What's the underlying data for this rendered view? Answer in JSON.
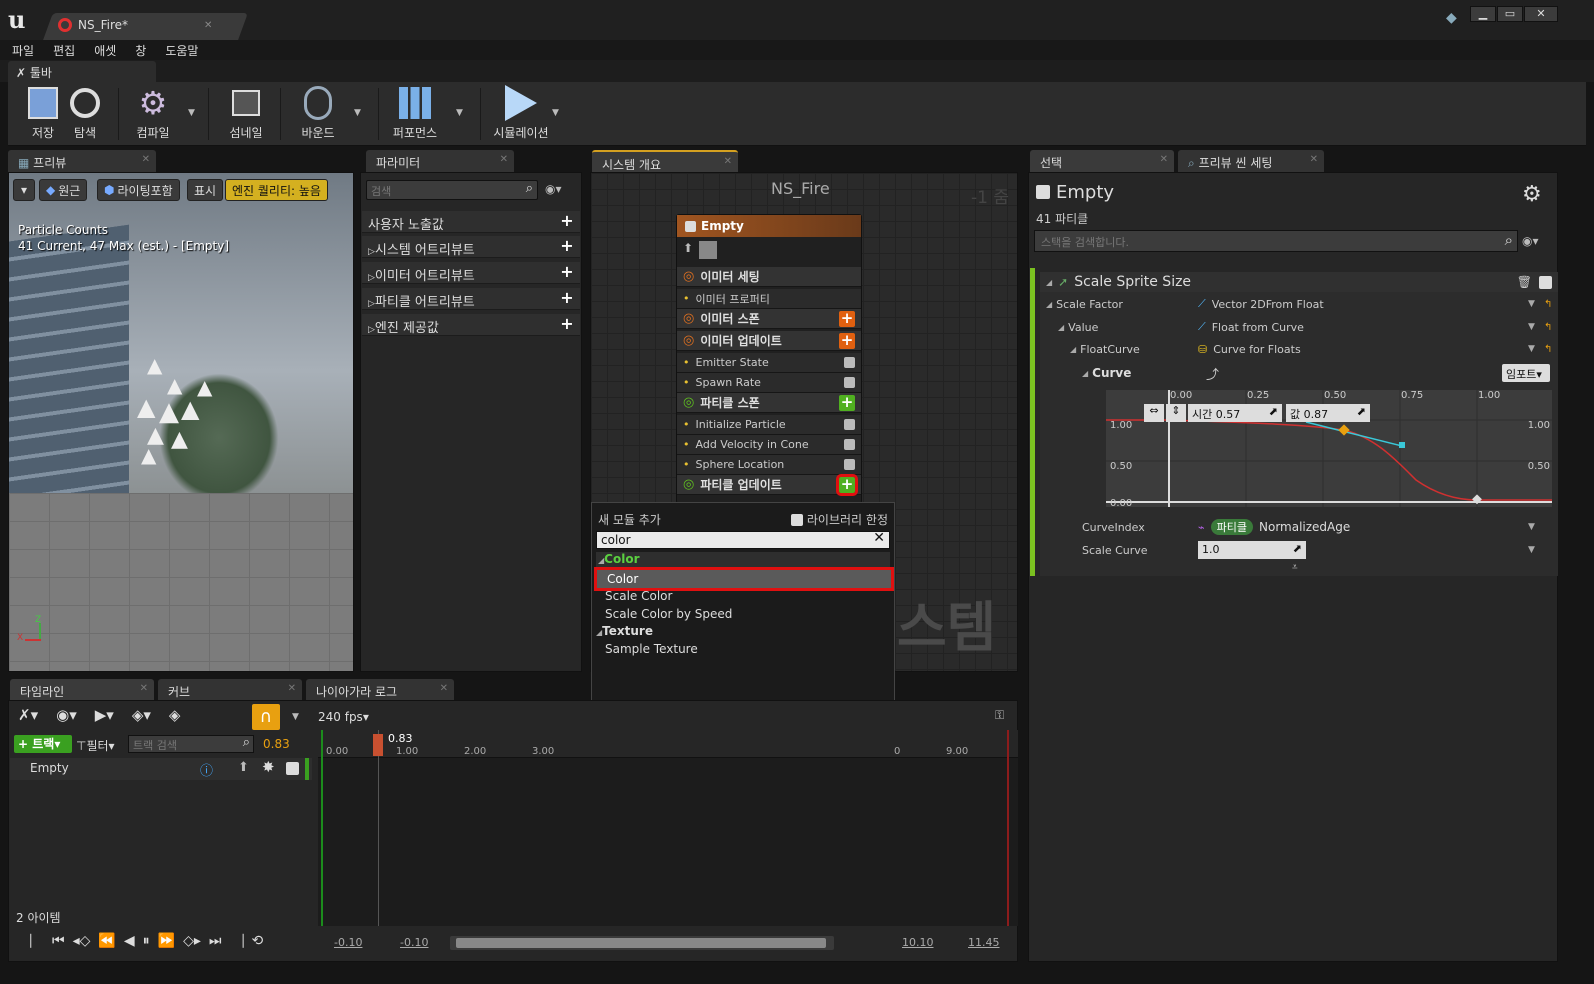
{
  "titlebar": {
    "tab_title": "NS_Fire*"
  },
  "menu": [
    "파일",
    "편집",
    "애셋",
    "창",
    "도움말"
  ],
  "toolbar_tab": "툴바",
  "toolbar": {
    "save": "저장",
    "browse": "탐색",
    "compile": "컴파일",
    "thumbnail": "섬네일",
    "bounds": "바운드",
    "performance": "퍼포먼스",
    "simulation": "시뮬레이션"
  },
  "preview": {
    "tab": "프리뷰",
    "perspective": "원근",
    "lighting": "라이팅포함",
    "show": "표시",
    "quality": "엔진 퀄리티: 높음",
    "stats_title": "Particle Counts",
    "stats_line": "41 Current, 47 Max (est.) - [Empty]"
  },
  "parameters": {
    "tab": "파라미터",
    "search_placeholder": "검색",
    "items": [
      "사용자 노출값",
      "시스템 어트리뷰트",
      "이미터 어트리뷰트",
      "파티클 어트리뷰트",
      "엔진 제공값"
    ]
  },
  "system_overview": {
    "tab": "시스템 개요",
    "title": "NS_Fire",
    "zoom": "-1 줌",
    "watermark": "스템",
    "node": {
      "name": "Empty",
      "sections": [
        {
          "label": "이미터 세팅",
          "type": "head",
          "color": "#e07020"
        },
        {
          "label": "이미터 프로퍼티",
          "type": "sub"
        },
        {
          "label": "이미터 스폰",
          "type": "head",
          "color": "#e07020",
          "add": "#e06010"
        },
        {
          "label": "이미터 업데이트",
          "type": "head",
          "color": "#e07020",
          "add": "#e06010"
        },
        {
          "label": "Emitter State",
          "type": "sub",
          "check": true
        },
        {
          "label": "Spawn Rate",
          "type": "sub",
          "check": true
        },
        {
          "label": "파티클 스폰",
          "type": "head",
          "color": "#60c020",
          "add": "#50b020"
        },
        {
          "label": "Initialize Particle",
          "type": "sub",
          "check": true
        },
        {
          "label": "Add Velocity in Cone",
          "type": "sub",
          "check": true
        },
        {
          "label": "Sphere Location",
          "type": "sub",
          "check": true
        },
        {
          "label": "파티클 업데이트",
          "type": "head",
          "color": "#60c020",
          "add": "#50b020"
        }
      ]
    }
  },
  "popup": {
    "title": "새 모듈 추가",
    "library_only": "라이브러리 한정",
    "search_value": "color",
    "groups": [
      {
        "name": "Color",
        "items": [
          "Color",
          "Scale Color",
          "Scale Color by Speed"
        ]
      },
      {
        "name": "Texture",
        "items": [
          "Sample Texture"
        ]
      }
    ]
  },
  "timeline": {
    "tabs": [
      "타임라인",
      "커브",
      "나이아가라 로그"
    ],
    "fps": "240 fps",
    "track_btn": "트랙",
    "filter_btn": "필터",
    "search_placeholder": "트랙 검색",
    "time_value": "0.83",
    "playhead": "0.83",
    "ruler": [
      "0.00",
      "1.00",
      "2.00",
      "3.00",
      "9.00"
    ],
    "ruler_partial": "0",
    "track": "Empty",
    "item_count": "2 아이템",
    "range_start": "-0.10",
    "range_start2": "-0.10",
    "range_end": "10.10",
    "range_end2": "11.45"
  },
  "details": {
    "tabs": [
      "선택",
      "프리뷰 씬 세팅"
    ],
    "title": "Empty",
    "subtitle": "41 파티클",
    "search_placeholder": "스택을 검색합니다.",
    "module": "Scale Sprite Size",
    "rows": [
      {
        "label": "Scale Factor",
        "value": "Vector 2DFrom Float"
      },
      {
        "label": "Value",
        "value": "Float from Curve"
      },
      {
        "label": "FloatCurve",
        "value": "Curve for Floats"
      },
      {
        "label": "Curve",
        "value": ""
      }
    ],
    "import_btn": "임포트",
    "curve": {
      "x_ticks": [
        "0.00",
        "0.25",
        "0.50",
        "0.75",
        "1.00"
      ],
      "y_ticks": [
        "1.00",
        "0.50",
        "0.00"
      ],
      "time_label": "시간",
      "time_value": "0.57",
      "value_label": "값",
      "value_value": "0.87"
    },
    "curve_index_label": "CurveIndex",
    "curve_index_tag": "파티클",
    "curve_index_value": "NormalizedAge",
    "scale_curve_label": "Scale Curve",
    "scale_curve_value": "1.0"
  },
  "colors": {
    "accent_green": "#50b020",
    "accent_orange": "#e06010",
    "highlight_red": "#e01010",
    "quality_yellow": "#d4b020"
  }
}
